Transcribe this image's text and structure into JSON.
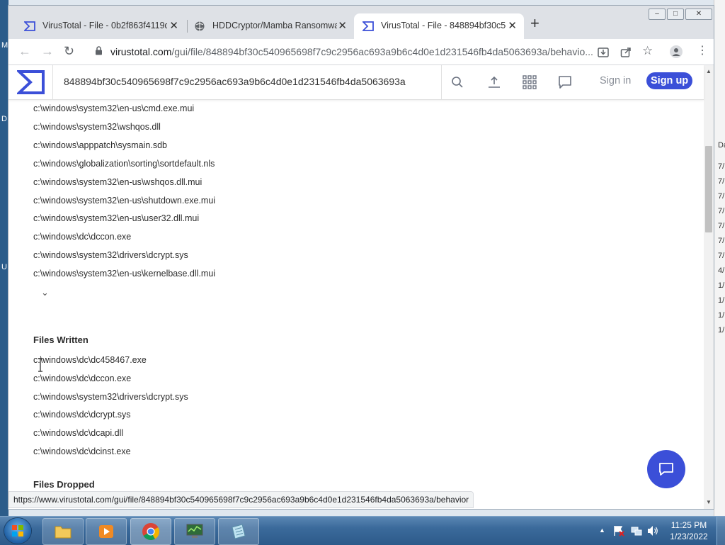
{
  "browser": {
    "tabs": [
      {
        "title": "VirusTotal - File - 0b2f863f4119d",
        "icon": "virustotal-icon",
        "active": false
      },
      {
        "title": "HDDCryptor/Mamba Ransomwar",
        "icon": "globe-icon",
        "active": false
      },
      {
        "title": "VirusTotal - File - 848894bf30c5",
        "icon": "virustotal-icon",
        "active": true
      }
    ],
    "new_tab_label": "+",
    "url_host": "virustotal.com",
    "url_path": "/gui/file/848894bf30c540965698f7c9c2956ac693a9b6c4d0e1d231546fb4da5063693a/behavio...",
    "status_url": "https://www.virustotal.com/gui/file/848894bf30c540965698f7c9c2956ac693a9b6c4d0e1d231546fb4da5063693a/behavior"
  },
  "vt": {
    "search_value": "848894bf30c540965698f7c9c2956ac693a9b6c4d0e1d231546fb4da5063693a",
    "sign_in": "Sign in",
    "sign_up": "Sign up",
    "brand_color": "#3b4fd8"
  },
  "files_opened": [
    "c:\\windows\\system32\\en-us\\cmd.exe.mui",
    "c:\\windows\\system32\\wshqos.dll",
    "c:\\windows\\apppatch\\sysmain.sdb",
    "c:\\windows\\globalization\\sorting\\sortdefault.nls",
    "c:\\windows\\system32\\en-us\\wshqos.dll.mui",
    "c:\\windows\\system32\\en-us\\shutdown.exe.mui",
    "c:\\windows\\system32\\en-us\\user32.dll.mui",
    "c:\\windows\\dc\\dccon.exe",
    "c:\\windows\\system32\\drivers\\dcrypt.sys",
    "c:\\windows\\system32\\en-us\\kernelbase.dll.mui"
  ],
  "files_written": {
    "title": "Files Written",
    "items": [
      "c:\\windows\\dc\\dc458467.exe",
      "c:\\windows\\dc\\dccon.exe",
      "c:\\windows\\system32\\drivers\\dcrypt.sys",
      "c:\\windows\\dc\\dcrypt.sys",
      "c:\\windows\\dc\\dcapi.dll",
      "c:\\windows\\dc\\dcinst.exe"
    ]
  },
  "files_dropped": {
    "title": "Files Dropped"
  },
  "desktop": {
    "left_letters": [
      "M",
      "D",
      "U"
    ],
    "right_labels": [
      "Da",
      "7/",
      "7/",
      "7/",
      "7/",
      "7/",
      "7/",
      "7/",
      "4/",
      "1/",
      "1/",
      "1/",
      "1/"
    ]
  },
  "taskbar": {
    "time": "11:25 PM",
    "date": "1/23/2022"
  }
}
